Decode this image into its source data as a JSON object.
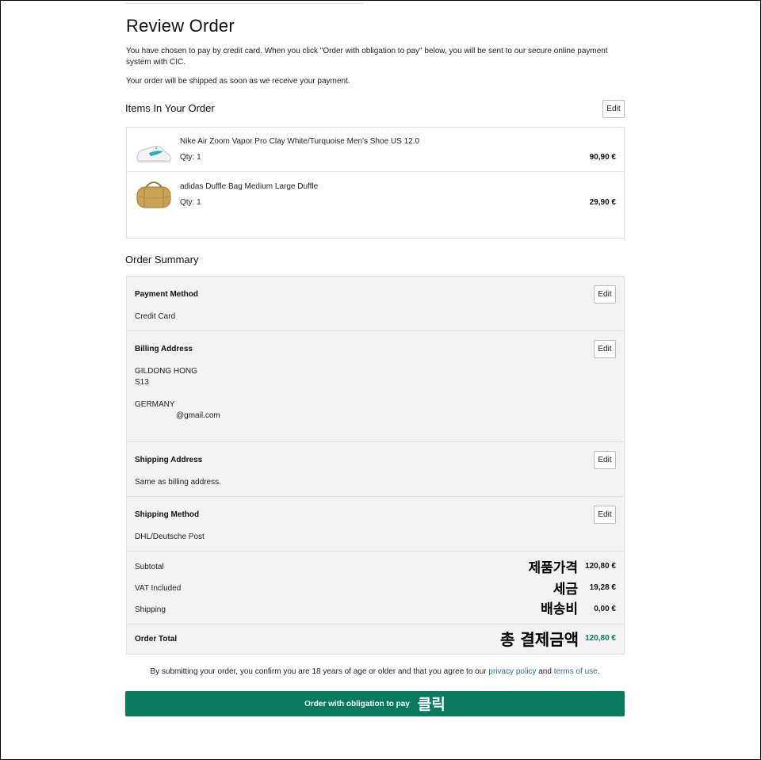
{
  "header": {
    "title": "Review Order",
    "intro": "You have chosen to pay by credit card. When you click \"Order with obligation to pay\" below, you will be sent to our secure online payment system with CIC.",
    "ship_note": "Your order will be shipped as soon as we receive your payment."
  },
  "items_section": {
    "title": "Items In Your Order",
    "edit_label": "Edit",
    "items": [
      {
        "name": "Nike Air Zoom Vapor Pro Clay White/Turquoise Men's Shoe US 12.0",
        "qty": "Qty: 1",
        "price": "90,90 €",
        "icon": "shoe-image"
      },
      {
        "name": "adidas Duffle Bag Medium Large Duffle",
        "qty": "Qty: 1",
        "price": "29,90 €",
        "icon": "duffle-bag-image"
      }
    ]
  },
  "summary": {
    "title": "Order Summary",
    "payment": {
      "heading": "Payment Method",
      "value": "Credit Card",
      "edit_label": "Edit"
    },
    "billing": {
      "heading": "Billing Address",
      "name": "GILDONG HONG",
      "line2": "S13",
      "country": "GERMANY",
      "email": "@gmail.com",
      "edit_label": "Edit"
    },
    "shipping_address": {
      "heading": "Shipping Address",
      "value": "Same as billing address.",
      "edit_label": "Edit"
    },
    "shipping_method": {
      "heading": "Shipping Method",
      "value": "DHL/Deutsche Post",
      "edit_label": "Edit"
    },
    "totals": {
      "subtotal_label": "Subtotal",
      "subtotal_value": "120,80 €",
      "subtotal_anno": "제품가격",
      "vat_label": "VAT Included",
      "vat_value": "19,28 €",
      "vat_anno": "세금",
      "shipping_label": "Shipping",
      "shipping_value": "0,00 €",
      "shipping_anno": "배송비",
      "total_label": "Order Total",
      "total_value": "120,80 €",
      "total_anno": "총 결제금액"
    }
  },
  "terms": {
    "prefix": "By submitting your order, you confirm you are 18 years of age or older and that you agree to our",
    "privacy": "privacy policy",
    "and": "and",
    "terms_link": "terms of use",
    "suffix": "."
  },
  "pay_button": {
    "label": "Order with obligation to pay",
    "anno": "클릭"
  },
  "colors": {
    "accent": "#087b5f",
    "link": "#2a6fb0",
    "summary_bg": "#f3f3f3"
  }
}
